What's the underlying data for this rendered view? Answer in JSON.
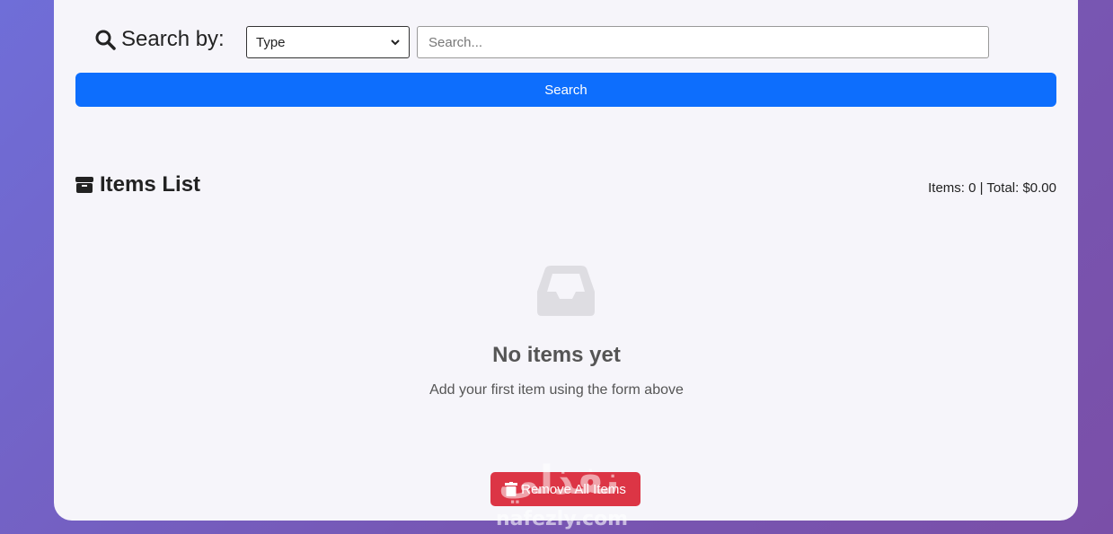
{
  "search": {
    "label": "Search by:",
    "type_selected": "Type",
    "placeholder": "Search...",
    "button_label": "Search"
  },
  "list": {
    "title": "Items List",
    "summary": "Items: 0 | Total: $0.00"
  },
  "empty_state": {
    "title": "No items yet",
    "subtitle": "Add your first item using the form above"
  },
  "actions": {
    "remove_all_label": "Remove All Items"
  },
  "watermark": {
    "arabic": "نفذلي",
    "latin": "nafezly.com"
  },
  "colors": {
    "primary": "#0d6efd",
    "danger": "#dc3545",
    "card_bg": "#f6f5fa"
  }
}
